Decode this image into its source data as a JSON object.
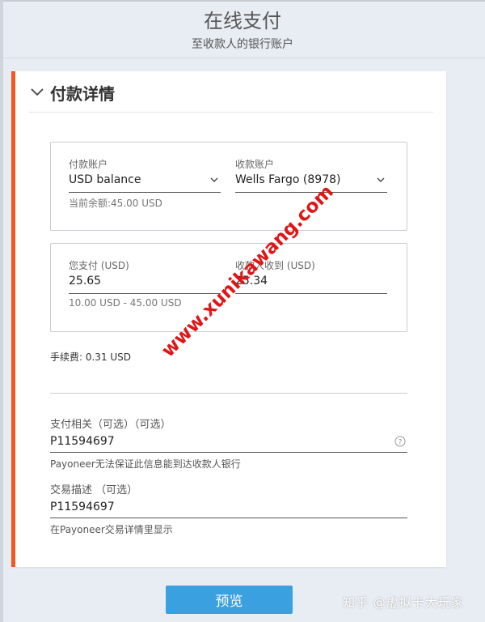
{
  "header": {
    "title": "在线支付",
    "subtitle": "至收款人的银行账户"
  },
  "section": {
    "title": "付款详情"
  },
  "accounts": {
    "payer": {
      "label": "付款账户",
      "value": "USD balance",
      "hint": "当前余额:45.00 USD"
    },
    "payee": {
      "label": "收款账户",
      "value": "Wells Fargo (8978)"
    }
  },
  "amounts": {
    "you_pay": {
      "label": "您支付 (USD)",
      "value": "25.65",
      "hint": "10.00 USD - 45.00 USD"
    },
    "recipient_gets": {
      "label": "收款人收到 (USD)",
      "value": "25.34"
    }
  },
  "fee_text": "手续费: 0.31 USD",
  "payment_reference": {
    "label": "支付相关（可选）（可选）",
    "value": "P11594697",
    "hint": "Payoneer无法保证此信息能到达收款人银行"
  },
  "transaction_description": {
    "label": "交易描述 （可选）",
    "value": "P11594697",
    "hint": "在Payoneer交易详情里显示"
  },
  "preview_button": "预览",
  "watermarks": {
    "corner": "知乎 @虚拟卡大玩家",
    "diagonal": "www.xunikawang.com"
  },
  "colors": {
    "accent": "#f05a22",
    "primary_button": "#3aa0e0",
    "watermark": "#e01616"
  },
  "icons": {
    "section_toggle": "chevron-down-icon",
    "dropdown": "chevron-down-icon",
    "help": "question-circle-icon"
  }
}
